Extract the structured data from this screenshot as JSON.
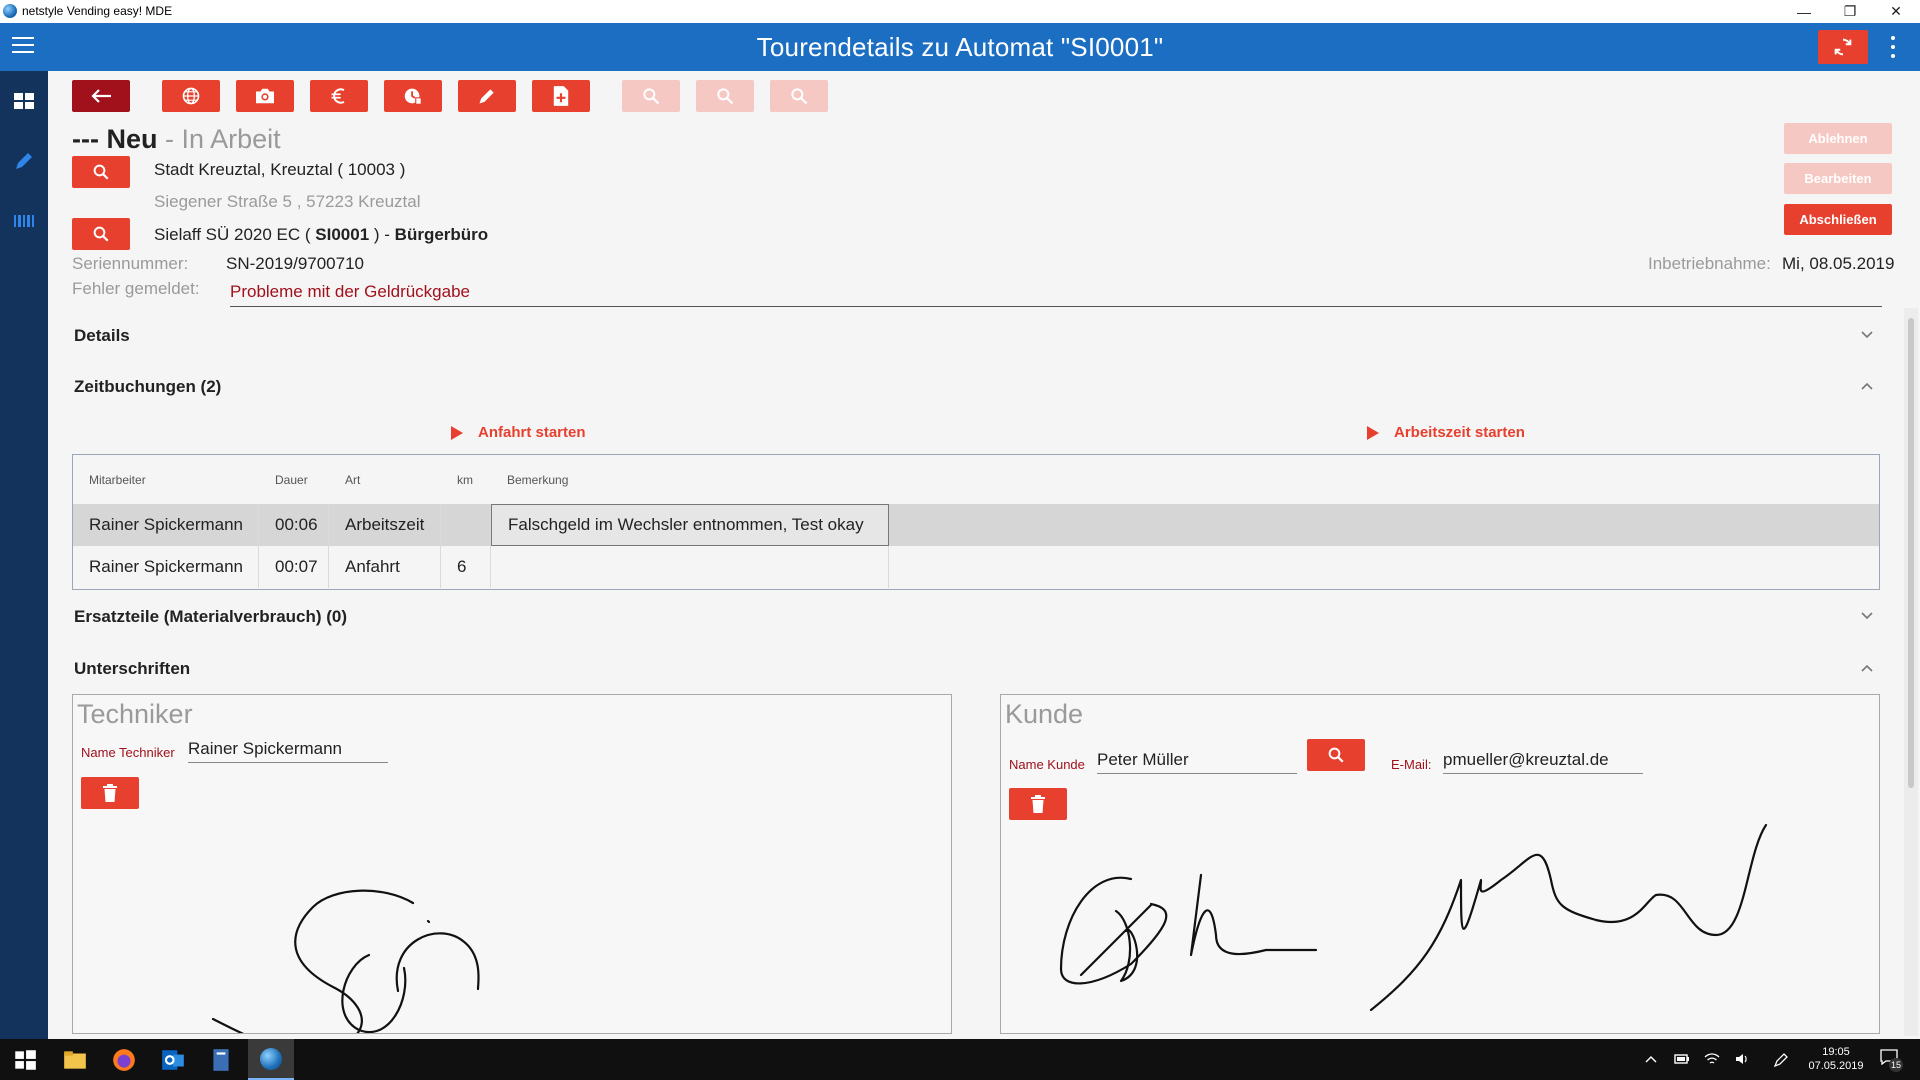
{
  "window": {
    "title": "netstyle Vending easy! MDE"
  },
  "header": {
    "title": "Tourendetails zu Automat \"SI0001\""
  },
  "status": {
    "prefix": "---",
    "current": "Neu",
    "separator": "-",
    "next": "In Arbeit"
  },
  "customer": {
    "name": "Stadt Kreuztal, Kreuztal ( 10003 )",
    "address": "Siegener Straße 5 , 57223  Kreuztal"
  },
  "machine": {
    "model": "Sielaff SÜ 2020 EC ( ",
    "id": "SI0001",
    "suffix": " ) - ",
    "location": "Bürgerbüro"
  },
  "serial": {
    "label": "Seriennummer:",
    "value": "SN-2019/9700710"
  },
  "commissioning": {
    "label": "Inbetriebnahme:",
    "value": "Mi, 08.05.2019"
  },
  "error": {
    "label": "Fehler gemeldet:",
    "value": "Probleme mit der Geldrückgabe"
  },
  "actions": {
    "reject": "Ablehnen",
    "edit": "Bearbeiten",
    "complete": "Abschließen"
  },
  "sections": {
    "details": "Details",
    "time_bookings": "Zeitbuchungen (2)",
    "spare_parts": "Ersatzteile (Materialverbrauch) (0)",
    "signatures": "Unterschriften"
  },
  "time_actions": {
    "start_travel": "Anfahrt starten",
    "start_work": "Arbeitszeit starten"
  },
  "table": {
    "headers": [
      "Mitarbeiter",
      "Dauer",
      "Art",
      "km",
      "Bemerkung"
    ],
    "rows": [
      [
        "Rainer Spickermann",
        "00:06",
        "Arbeitszeit",
        "",
        "Falschgeld im Wechsler entnommen, Test okay"
      ],
      [
        "Rainer Spickermann",
        "00:07",
        "Anfahrt",
        "6",
        ""
      ]
    ]
  },
  "technician": {
    "title": "Techniker",
    "name_label": "Name Techniker",
    "name_value": "Rainer Spickermann"
  },
  "customer_sig": {
    "title": "Kunde",
    "name_label": "Name Kunde",
    "name_value": "Peter Müller",
    "email_label": "E-Mail:",
    "email_value": "pmueller@kreuztal.de"
  },
  "taskbar": {
    "time": "19:05",
    "date": "07.05.2019",
    "notifications": "15"
  },
  "colors": {
    "primary_blue": "#1b6ec2",
    "sidebar": "#13335d",
    "accent_red": "#e8402f",
    "dark_red": "#a0111c",
    "faded_red": "#f6c8c3"
  },
  "icons": [
    "back-arrow-icon",
    "globe-icon",
    "camera-icon",
    "euro-icon",
    "clock-icon",
    "pencil-icon",
    "add-document-icon",
    "zoom-icon",
    "search-icon",
    "trash-icon",
    "sync-icon",
    "menu-icon",
    "dashboard-icon",
    "barcode-icon"
  ]
}
